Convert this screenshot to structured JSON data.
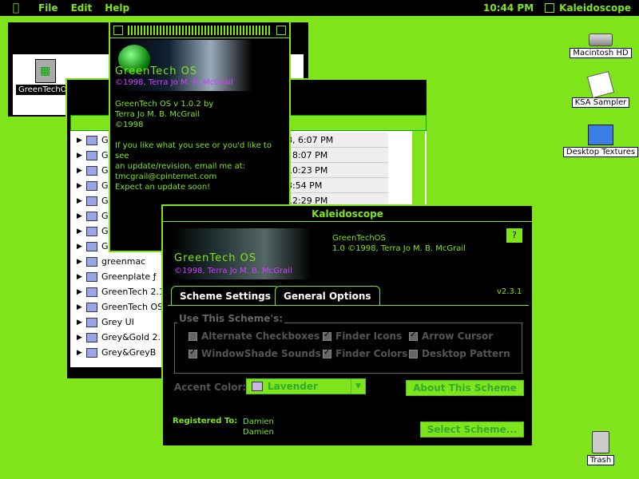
{
  "menubar": {
    "items": [
      "File",
      "Edit",
      "Help"
    ],
    "clock": "10:44 PM",
    "app": "Kaleidoscope"
  },
  "finder_small": {
    "file": "GreenTechOS"
  },
  "finder_list": {
    "rows": [
      {
        "name": "G",
        "date": "7, 1998, 6:07 PM"
      },
      {
        "name": "G",
        "date": ", 2002, 8:07 PM"
      },
      {
        "name": "G",
        "date": "1998, 10:23 PM"
      },
      {
        "name": "G",
        "date": "1997, 3:54 PM"
      },
      {
        "name": "G",
        "date": "2000, 12:29 PM"
      },
      {
        "name": "G",
        "date": ""
      },
      {
        "name": "G",
        "date": ""
      },
      {
        "name": "G",
        "date": ""
      },
      {
        "name": "greenmac",
        "date": ""
      },
      {
        "name": "Greenplate ƒ",
        "date": ""
      },
      {
        "name": "GreenTech 2.1",
        "date": ""
      },
      {
        "name": "GreenTech OS a",
        "date": ""
      },
      {
        "name": "Grey UI",
        "date": ""
      },
      {
        "name": "Grey&Gold 2.1",
        "date": ""
      },
      {
        "name": "Grey&GreyB",
        "date": ""
      }
    ]
  },
  "about": {
    "brand": "GreenTech OS",
    "copyright": "©1998, Terra Jo M. B. McGrail",
    "body": "GreenTech OS v 1.0.2 by\nTerra Jo M. B. McGrail\n©1998\n\nIf you like what you see or you'd like to see\nan update/revision, email me at:\ntmcgrail@cpinternet.com\nExpect an update soon!"
  },
  "kaleidoscope": {
    "title": "Kaleidoscope",
    "scheme_name": "GreenTechOS",
    "scheme_version": "1.0 ©1998, Terra Jo M. B. McGrail",
    "logo_text": "GreenTech OS",
    "logo_copy": "©1998, Terra Jo M. B. McGrail",
    "help": "?",
    "version": "v2.3.1",
    "tabs": [
      "Scheme Settings",
      "General Options"
    ],
    "group_label": "Use This Scheme's:",
    "options": [
      {
        "label": "Alternate Checkboxes",
        "checked": false
      },
      {
        "label": "Finder Icons",
        "checked": true
      },
      {
        "label": "Arrow Cursor",
        "checked": true
      },
      {
        "label": "WindowShade Sounds",
        "checked": true
      },
      {
        "label": "Finder Colors",
        "checked": true
      },
      {
        "label": "Desktop Pattern",
        "checked": false
      }
    ],
    "accent_label": "Accent Color:",
    "accent_value": "Lavender",
    "about_button": "About This Scheme",
    "registered_label": "Registered To:",
    "registered_name": "Damien",
    "registered_org": "Damien",
    "select_button": "Select Scheme..."
  },
  "desktop": [
    "Macintosh HD",
    "KSA Sampler",
    "Desktop Textures",
    "Trash"
  ]
}
